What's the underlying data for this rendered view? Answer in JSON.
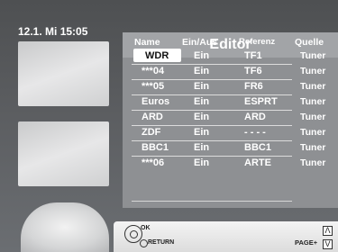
{
  "status": {
    "date_time": "12.1.  Mi   15:05"
  },
  "editor": {
    "title": "Editor",
    "headers": {
      "name": "Name",
      "ein_aus": "Ein/Aus",
      "referenz": "Referenz",
      "quelle": "Quelle"
    },
    "rows": [
      {
        "name": "WDR",
        "ein_aus": "Ein",
        "referenz": "TF1",
        "quelle": "Tuner",
        "selected": true
      },
      {
        "name": "***04",
        "ein_aus": "Ein",
        "referenz": "TF6",
        "quelle": "Tuner"
      },
      {
        "name": "***05",
        "ein_aus": "Ein",
        "referenz": "FR6",
        "quelle": "Tuner"
      },
      {
        "name": "Euros",
        "ein_aus": "Ein",
        "referenz": "ESPRT",
        "quelle": "Tuner"
      },
      {
        "name": "ARD",
        "ein_aus": "Ein",
        "referenz": "ARD",
        "quelle": "Tuner"
      },
      {
        "name": "ZDF",
        "ein_aus": "Ein",
        "referenz": "- - - -",
        "quelle": "Tuner"
      },
      {
        "name": "BBC1",
        "ein_aus": "Ein",
        "referenz": "BBC1",
        "quelle": "Tuner"
      },
      {
        "name": "***06",
        "ein_aus": "Ein",
        "referenz": "ARTE",
        "quelle": "Tuner"
      }
    ]
  },
  "footer": {
    "ok_label": "OK",
    "return_label": "RETURN",
    "page_label": "PAGE+",
    "up_arrow": "Λ",
    "down_arrow": "V"
  }
}
